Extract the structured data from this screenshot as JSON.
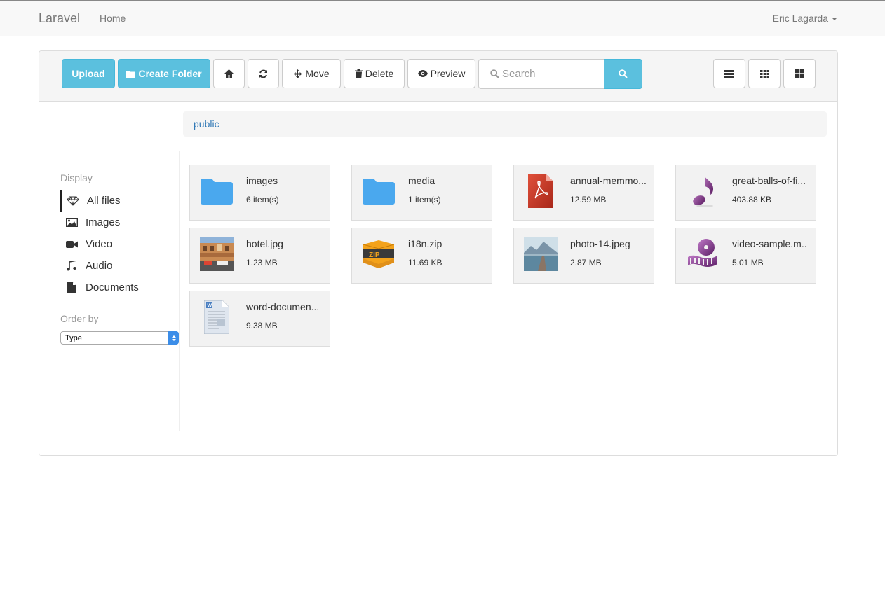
{
  "navbar": {
    "brand": "Laravel",
    "home": "Home",
    "user": "Eric Lagarda"
  },
  "toolbar": {
    "upload": "Upload",
    "create_folder": "Create Folder",
    "move": "Move",
    "delete": "Delete",
    "preview": "Preview",
    "search_placeholder": "Search"
  },
  "breadcrumb": {
    "current": "public"
  },
  "sidebar": {
    "display_heading": "Display",
    "items": [
      {
        "label": "All files",
        "icon": "diamond-icon",
        "active": true
      },
      {
        "label": "Images",
        "icon": "picture-icon",
        "active": false
      },
      {
        "label": "Video",
        "icon": "video-camera-icon",
        "active": false
      },
      {
        "label": "Audio",
        "icon": "music-note-icon",
        "active": false
      },
      {
        "label": "Documents",
        "icon": "document-icon",
        "active": false
      }
    ],
    "order_heading": "Order by",
    "order_value": "Type"
  },
  "files": [
    {
      "name": "images",
      "meta": "6 item(s)",
      "kind": "folder"
    },
    {
      "name": "media",
      "meta": "1 item(s)",
      "kind": "folder"
    },
    {
      "name": "annual-memmo...",
      "meta": "12.59 MB",
      "kind": "pdf"
    },
    {
      "name": "great-balls-of-fi...",
      "meta": "403.88 KB",
      "kind": "audio"
    },
    {
      "name": "hotel.jpg",
      "meta": "1.23 MB",
      "kind": "image-hotel"
    },
    {
      "name": "i18n.zip",
      "meta": "11.69 KB",
      "kind": "zip"
    },
    {
      "name": "photo-14.jpeg",
      "meta": "2.87 MB",
      "kind": "image-lake"
    },
    {
      "name": "video-sample.m..",
      "meta": "5.01 MB",
      "kind": "video"
    },
    {
      "name": "word-documen...",
      "meta": "9.38 MB",
      "kind": "word"
    }
  ],
  "colors": {
    "info": "#5bc0de",
    "folder": "#4aa8ee",
    "link": "#337ab7"
  }
}
